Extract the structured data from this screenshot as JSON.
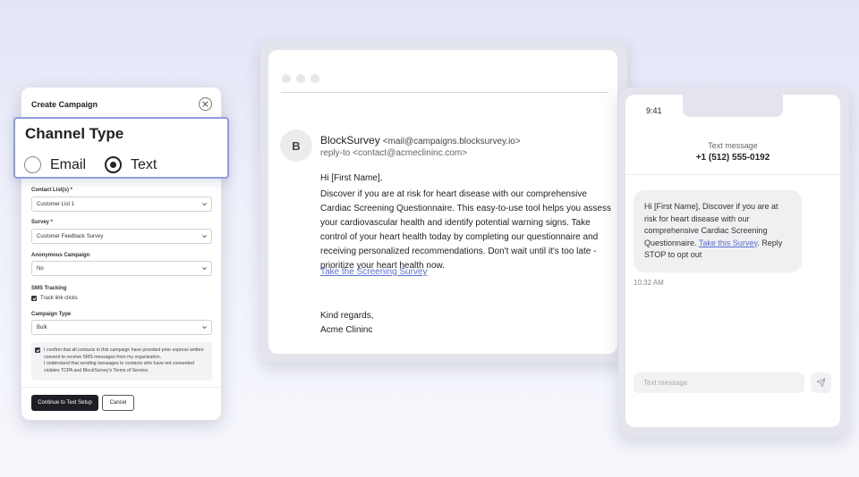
{
  "email": {
    "avatar_initial": "B",
    "sender_name": "BlockSurvey",
    "sender_address": "<mail@campaigns.blocksurvey.io>",
    "reply_to": "reply-to <contact@acmeclininc.com>",
    "greeting": "Hi [First Name],",
    "body": "Discover if you are at risk for heart disease with our comprehensive Cardiac Screening Questionnaire. This easy-to-use tool helps you assess your cardiovascular health and identify potential warning signs. Take control of your heart health today by completing our questionnaire and receiving personalized recommendations. Don't wait until it's too late - prioritize your heart health now.",
    "link_label": "Take the Screening Survey",
    "signoff": "Kind regards,",
    "signature": "Acme Clininc"
  },
  "phone": {
    "status_time": "9:41",
    "header_label": "Text message",
    "phone_number": "+1 (512) 555-0192",
    "message_text": "Hi [First Name], Discover if you are at risk for heart disease with our comprehensive Cardiac Screening Questionnaire.",
    "message_link": "Take this Survey",
    "message_suffix": ". Reply STOP to opt out",
    "message_time": "10:32 AM",
    "input_placeholder": "Text message",
    "send_icon": "send-icon"
  },
  "campaign": {
    "title": "Create Campaign",
    "contact_list_label": "Contact List(s) *",
    "contact_list_value": "Customer List 1",
    "survey_label": "Survey *",
    "survey_value": "Customer Feedback Survey",
    "anonymous_label": "Anonymous Campaign",
    "anonymous_value": "No",
    "sms_tracking_label": "SMS Tracking",
    "track_clicks_label": "Track link clicks",
    "track_clicks_checked": true,
    "campaign_type_label": "Campaign Type",
    "campaign_type_value": "Bulk",
    "consent_line1": "I confirm that all contacts in this campaign have provided prior express written consent to receive SMS messages from my organization.",
    "consent_line2": "I understand that sending messages to contacts who have not consented violates TCPA and BlockSurvey's Terms of Service.",
    "consent_checked": true,
    "continue_button": "Continue to Text Setup",
    "cancel_button": "Cancel"
  },
  "channel_type": {
    "title": "Channel Type",
    "options": [
      {
        "label": "Email",
        "selected": false
      },
      {
        "label": "Text",
        "selected": true
      }
    ]
  },
  "colors": {
    "accent": "#8f9fdb",
    "link": "#5b6fd6",
    "primary_button": "#1e1e24"
  }
}
